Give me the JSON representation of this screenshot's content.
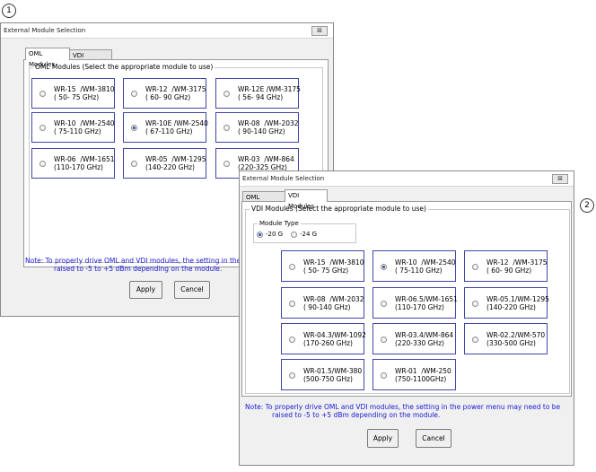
{
  "callouts": [
    "1",
    "2"
  ],
  "dialog1": {
    "title": "External Module Selection",
    "close_icon_text": "⊠",
    "tabs": [
      "OML Modules",
      "VDI Modules"
    ],
    "group_label": "OML Modules (Select the appropriate module to use)",
    "modules": [
      {
        "line1": "WR-15  /WM-3810",
        "line2": "( 50- 75 GHz)",
        "selected": false
      },
      {
        "line1": "WR-12  /WM-3175",
        "line2": "( 60- 90 GHz)",
        "selected": false
      },
      {
        "line1": "WR-12E /WM-3175",
        "line2": "( 56- 94 GHz)",
        "selected": false
      },
      {
        "line1": "WR-10  /WM-2540",
        "line2": "( 75-110 GHz)",
        "selected": false
      },
      {
        "line1": "WR-10E /WM-2540",
        "line2": "( 67-110 GHz)",
        "selected": true
      },
      {
        "line1": "WR-08  /WM-2032",
        "line2": "( 90-140 GHz)",
        "selected": false
      },
      {
        "line1": "WR-06  /WM-1651",
        "line2": "(110-170 GHz)",
        "selected": false
      },
      {
        "line1": "WR-05  /WM-1295",
        "line2": "(140-220 GHz)",
        "selected": false
      },
      {
        "line1": "WR-03  /WM-864",
        "line2": "(220-325 GHz)",
        "selected": false
      }
    ],
    "note_line1": "Note: To properly drive OML and VDI modules, the setting in the power me",
    "note_line2": "raised to -5 to +5 dBm depending on the module.",
    "apply": "Apply",
    "cancel": "Cancel"
  },
  "dialog2": {
    "title": "External Module Selection",
    "close_icon_text": "⊠",
    "tabs": [
      "OML Modules",
      "VDI Modules"
    ],
    "group_label": "VDI Modules (Select the appropriate module to use)",
    "module_type_label": "Module Type",
    "module_type_options": [
      {
        "label": "-20 G",
        "selected": true
      },
      {
        "label": "-24 G",
        "selected": false
      }
    ],
    "modules": [
      {
        "line1": "WR-15  /WM-3810",
        "line2": "( 50- 75 GHz)",
        "selected": false
      },
      {
        "line1": "WR-10  /WM-2540",
        "line2": "( 75-110 GHz)",
        "selected": true
      },
      {
        "line1": "WR-12  /WM-3175",
        "line2": "( 60- 90 GHz)",
        "selected": false
      },
      {
        "line1": "WR-08  /WM-2032",
        "line2": "( 90-140 GHz)",
        "selected": false
      },
      {
        "line1": "WR-06.5/WM-1651",
        "line2": "(110-170 GHz)",
        "selected": false
      },
      {
        "line1": "WR-05.1/WM-1295",
        "line2": "(140-220 GHz)",
        "selected": false
      },
      {
        "line1": "WR-04.3/WM-1092",
        "line2": "(170-260 GHz)",
        "selected": false
      },
      {
        "line1": "WR-03.4/WM-864",
        "line2": "(220-330 GHz)",
        "selected": false
      },
      {
        "line1": "WR-02.2/WM-570",
        "line2": "(330-500 GHz)",
        "selected": false
      },
      {
        "line1": "WR-01.5/WM-380",
        "line2": "(500-750 GHz)",
        "selected": false
      },
      {
        "line1": "WR-01  /WM-250",
        "line2": "(750-1100GHz)",
        "selected": false
      }
    ],
    "note_line1": "Note: To properly drive OML and VDI modules, the setting in the power menu may need to be",
    "note_line2": "raised to -5 to +5 dBm depending on the module.",
    "apply": "Apply",
    "cancel": "Cancel"
  }
}
